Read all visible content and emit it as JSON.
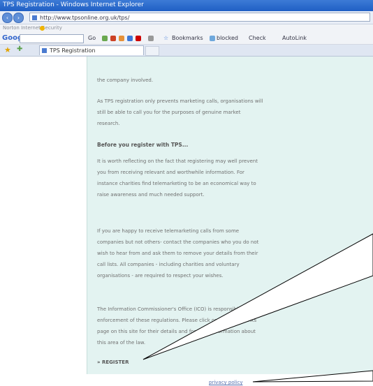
{
  "window": {
    "title": "TPS Registration - Windows Internet Explorer"
  },
  "address_bar": {
    "url": "http://www.tpsonline.org.uk/tps/"
  },
  "links_bar": {
    "label": "Norton Internet Security"
  },
  "google_toolbar": {
    "logo": "Google",
    "go_label": "Go",
    "bookmarks_label": "Bookmarks",
    "blocked_label": "blocked",
    "check_label": "Check",
    "autolink_label": "AutoLink"
  },
  "tab": {
    "label": "TPS Registration"
  },
  "content": {
    "para_top": "the company involved.",
    "para_research": "As TPS registration only prevents marketing calls, organisations will still be able to call you for the purposes of genuine market research.",
    "heading": "Before you register with TPS...",
    "para_reflect": "It is worth reflecting on the fact that registering may well prevent you from receiving relevant and worthwhile information. For instance charities find telemarketing to be an economical way to raise awareness and much needed support.",
    "para_happy": "If you are happy to receive telemarketing calls from some companies but not others- contact the companies who you do not wish to hear from and ask them to remove your details from their call lists. All companies - including charities and voluntary organisations - are required to respect your wishes.",
    "para_ico": "The Information Commissioner's Office (ICO) is responsible for the enforcement of these regulations. Please click on the useful links page on this site for their details and for more information about this area of the law.",
    "register_label": "» REGISTER",
    "privacy_label": "privacy policy"
  }
}
